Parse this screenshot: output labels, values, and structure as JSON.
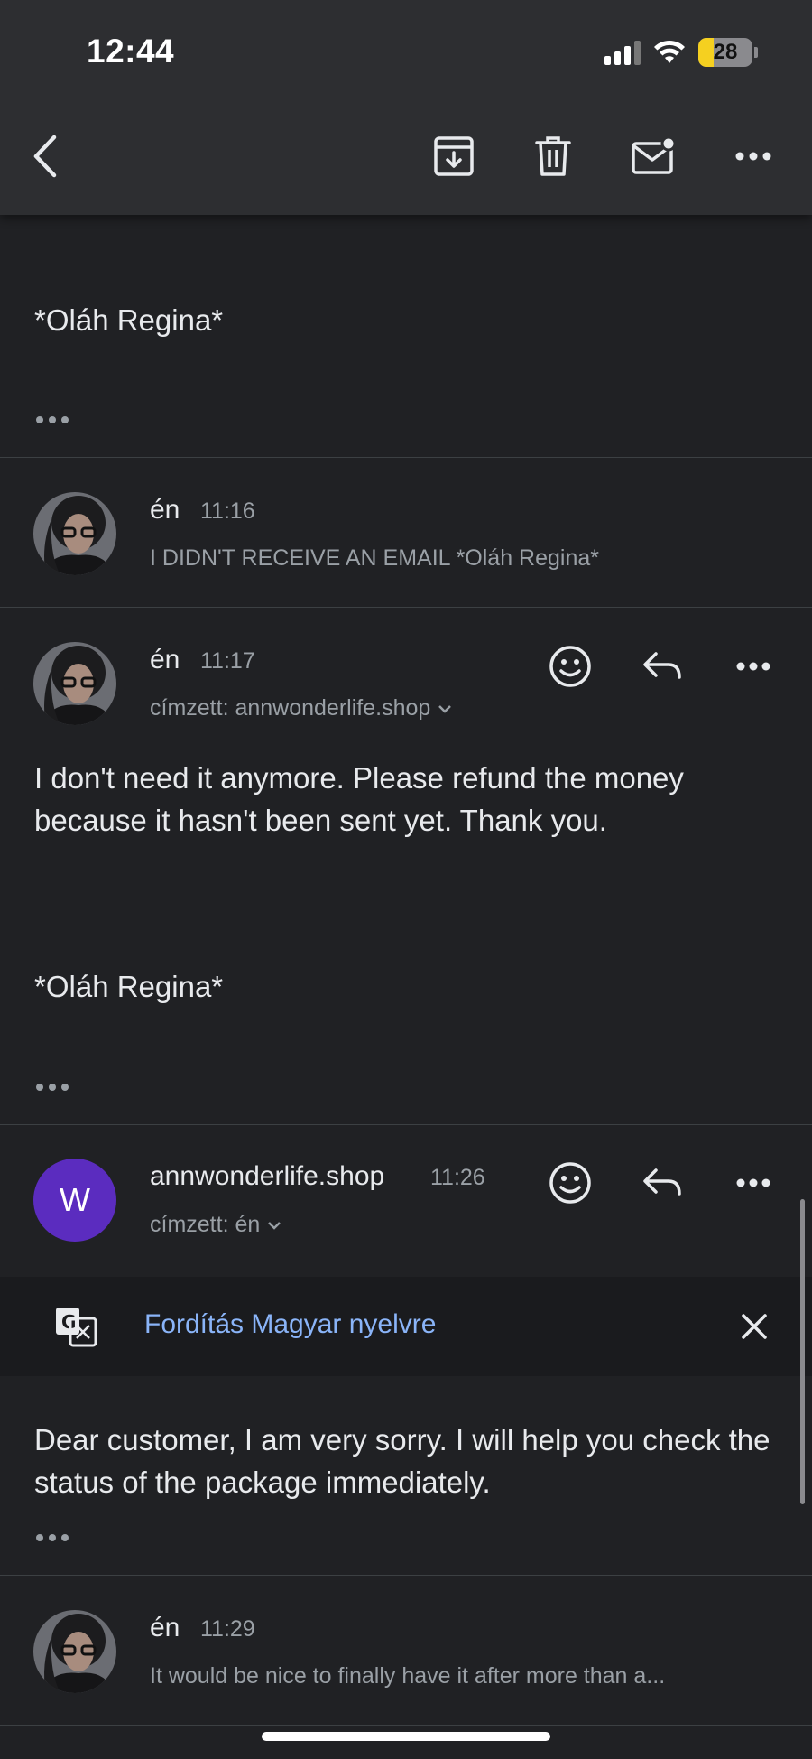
{
  "status_bar": {
    "time": "12:44",
    "battery": "28",
    "battery_level": 0.28
  },
  "colors": {
    "background": "#202124",
    "toolbar": "#2d2e31",
    "accent_link": "#8ab4f8",
    "avatar_w": "#5b2cbf"
  },
  "toolbar": {
    "back": "back-icon",
    "archive": "archive-icon",
    "delete": "trash-icon",
    "mark_unread": "mark-unread-icon",
    "more": "more-icon"
  },
  "partial_message": {
    "signature": "*Oláh Regina*"
  },
  "messages": [
    {
      "sender": "én",
      "time": "11:16",
      "snippet": "I DIDN'T RECEIVE AN EMAIL *Oláh Regina*"
    },
    {
      "sender": "én",
      "time": "11:17",
      "recipient": "címzett: annwonderlife.shop",
      "body": "I don't need it anymore. Please refund the money because it hasn't been sent yet. Thank you.",
      "signature": "*Oláh Regina*"
    },
    {
      "sender": "annwonderlife.shop",
      "time": "11:26",
      "avatar_letter": "W",
      "recipient": "címzett: én",
      "translate_label": "Fordítás Magyar nyelvre",
      "body": "Dear customer, I am very sorry. I will help you check the status of the package immediately."
    },
    {
      "sender": "én",
      "time": "11:29",
      "snippet": "It would be nice to finally have it after more than a..."
    }
  ]
}
